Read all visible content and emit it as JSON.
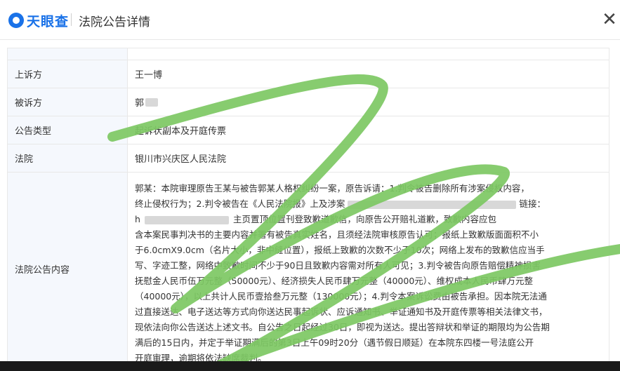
{
  "header": {
    "logo_text": "天眼查",
    "title": "法院公告详情",
    "close_glyph": "✕",
    "logo_color": "#1a72e8"
  },
  "rows": [
    {
      "label": "上诉方",
      "value": "王一博"
    },
    {
      "label": "被诉方",
      "value": "郭"
    },
    {
      "label": "公告类型",
      "value": "起诉状副本及开庭传票"
    },
    {
      "label": "法院",
      "value": "银川市兴庆区人民法院"
    },
    {
      "label": "法院公告内容",
      "value": ""
    }
  ],
  "content_lines": [
    "郭某：本院审理原告王某与被告郭某人格权纠纷一案，原告诉请：1.判令被告删除所有涉案侵权内容，",
    "终止侵权行为；2.判令被告在《人民法院报》上及涉案",
    "链接：",
    "h",
    "主页置顶位置刊登致歉道歉信，向原告公开赔礼道歉，致歉内容应包",
    "含本案民事判决书的主要内容并署有被告真实姓名，且须经法院审核原告认可；报纸上致歉版面面积不小",
    "于6.0cmX9.0cm（名片大小，非中缝位置），报纸上致歉的次数不少于10次；网络上发布的致歉信应当手",
    "写、字迹工整，网络中致歉时间不少于90日且致歉内容需对所有人可见；3.判令被告向原告赔偿精神损害",
    "抚慰金人民币伍万元整（50000元）、经济损失人民币肆万元整（40000元）、维权成本人民币肆万元整",
    "（40000元），以上共计人民币壹拾叁万元整（130000元）；4.判令本案诉讼费由被告承担。因本院无法通",
    "过直接送达、电子送达等方式向你送达民事起诉状、应诉通知书、举证通知书及开庭传票等相关法律文书，",
    "现依法向你公告送达上述文书。自公告之日起经过30日，即视为送达。提出答辩状和举证的期限均为公告期",
    "满后的15日内，并定于举证期满后的第3日上午09时20分（遇节假日顺延）在本院东四楼一号法庭公开",
    "开庭审理，逾期将依法缺席裁判。"
  ],
  "marker_color": "#7dc863"
}
